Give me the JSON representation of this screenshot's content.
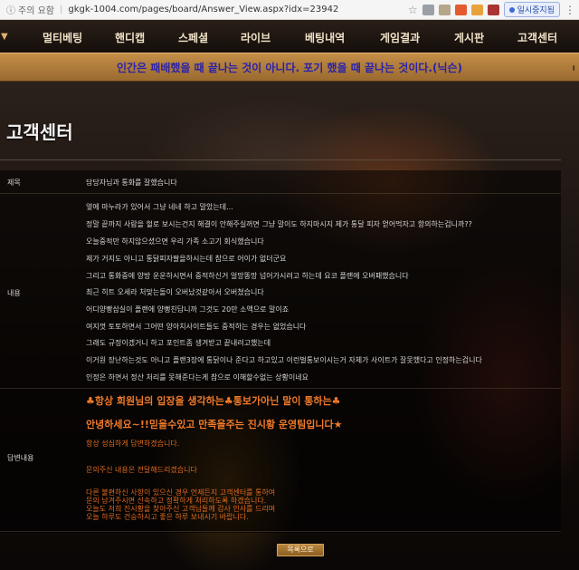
{
  "browser": {
    "security": "주의 요함",
    "url": "gkgk-1004.com/pages/board/Answer_View.aspx?idx=23942",
    "pause_label": "일시중지됨"
  },
  "nav": {
    "items": [
      "멀티베팅",
      "핸디캡",
      "스페셜",
      "라이브",
      "베팅내역",
      "게임결과",
      "게시판",
      "고객센터"
    ]
  },
  "banner": {
    "text": "인간은 패배했을 때 끝나는 것이 아니다. 포기 했을 때 끝나는 것이다.(닉슨)"
  },
  "page_title": "고객센터",
  "post": {
    "subject_label": "제목",
    "subject": "담당자님과 통화를 잘했습니다",
    "content_label": "내용",
    "content_lines": [
      "옆에 마누라가 있어서 그냥 네네 하고 말았는데...",
      "정말 끝까지 사람을 헐로 보시는건지 해결이 안해주실꺼면 그냥 말이도 하지마시지 제가 통달 피자 얻어먹자고 항의하는겁니까??",
      "오늘중적만 하지않으셨으면 우리 가족 소고기 회식했습니다",
      "제가 거지도 아니고 통닭피자팔을하시는데 참으로 어이가 없더군요",
      "그리고 통화중에 양방 운운하시면서 중적하신거 얼망똥망 넘어가시려고 하는데 요코 플랜에 오버패했습니다",
      "최근 히트 오세라 처맞는돌이 오버났것같아서 오버쳤습니다",
      "어디양빵삼실이 플랜에 양뻥친답니까 그것도 20만 소액으로 말이죠",
      "여지껏 토토하면서 그어떤 양아치사이트들도 중적하는 경우는 없었습니다",
      "그래도 규정이겠거니 하고 포인트좀 생겨받고 끝내려고했는데",
      "이거원 장난하는것도 아니고 플랜3장에 통닭이나 준다고 하고있고 이런벌통보이시는거 자체가 사이트가 잘못했다고 인정하는겁니다",
      "인정은 하면서 정산 처리를 못해준다는게 참으로 이해할수없는 상황이네요"
    ],
    "answer_label": "답변내용",
    "answer_headline_1": "♣항상 회원님의 입장을 생각하는♣통보가아닌 말이 통하는♣",
    "answer_headline_2": "안녕하세요~!!믿을수있고 만족을주는 진시황 운영팀입니다★",
    "answer_lines_1": [
      "항상 성심하게 답변하겠습니다."
    ],
    "answer_lines_2": [
      "문의주신 내용은 전달해드리겠습니다"
    ],
    "answer_lines_3": [
      "다른 불편하신 사항이 있으신 경우 언제든지 고객센터를 통하여",
      "문의 남겨주시면 신속하고 정확하게 처리하도록 하겠습니다.",
      "오늘도 저희 진시황을 찾아주신 고객님들께 감사 인사를 드리며",
      "오늘 하루도 건승하시고 좋은 하루 보내시기 바랍니다."
    ]
  },
  "list_button": "목록으로"
}
